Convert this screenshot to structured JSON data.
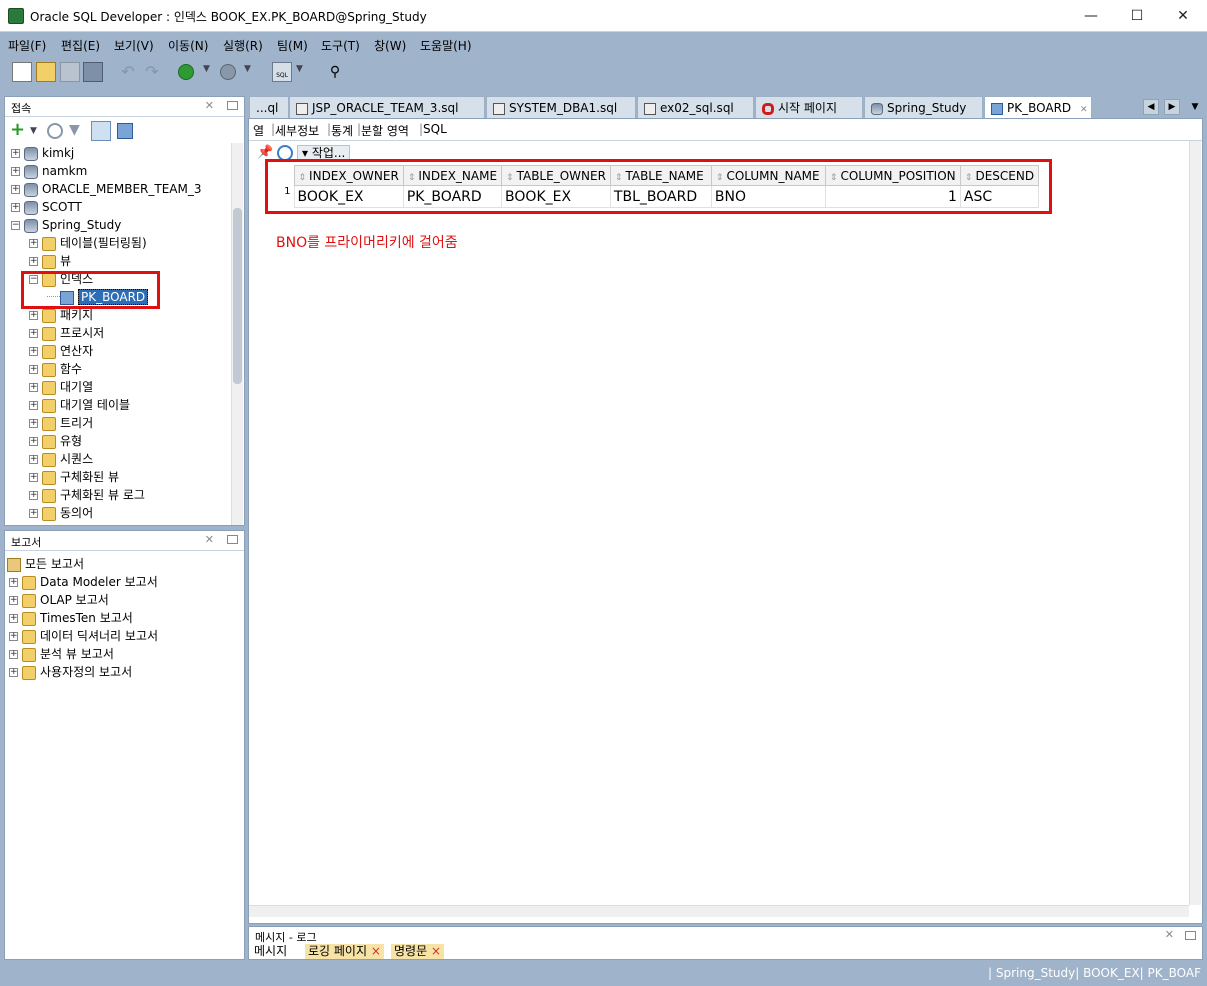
{
  "window": {
    "title": "Oracle SQL Developer : 인덱스 BOOK_EX.PK_BOARD@Spring_Study",
    "minimize": "—",
    "maximize": "☐",
    "close": "✕"
  },
  "menu": [
    "파일(F)",
    "편집(E)",
    "보기(V)",
    "이동(N)",
    "실행(R)",
    "팀(M)",
    "도구(T)",
    "창(W)",
    "도움말(H)"
  ],
  "connections_panel": {
    "title": "접속",
    "items": [
      {
        "label": "kimkj",
        "icon": "database-icon",
        "level": 0,
        "expander": "+"
      },
      {
        "label": "namkm",
        "icon": "database-icon",
        "level": 0,
        "expander": "+"
      },
      {
        "label": "ORACLE_MEMBER_TEAM_3",
        "icon": "database-icon",
        "level": 0,
        "expander": "+"
      },
      {
        "label": "SCOTT",
        "icon": "database-icon",
        "level": 0,
        "expander": "+"
      },
      {
        "label": "Spring_Study",
        "icon": "database-icon",
        "level": 0,
        "expander": "−"
      },
      {
        "label": "테이블(필터링됨)",
        "icon": "folder-icon",
        "level": 1,
        "expander": "+"
      },
      {
        "label": "뷰",
        "icon": "folder-icon",
        "level": 1,
        "expander": "+"
      },
      {
        "label": "인덱스",
        "icon": "folder-icon",
        "level": 1,
        "expander": "−"
      },
      {
        "label": "PK_BOARD",
        "icon": "index-icon",
        "level": 2,
        "expander": "",
        "selected": true
      },
      {
        "label": "패키지",
        "icon": "folder-icon",
        "level": 1,
        "expander": "+"
      },
      {
        "label": "프로시저",
        "icon": "folder-icon",
        "level": 1,
        "expander": "+"
      },
      {
        "label": "연산자",
        "icon": "folder-icon",
        "level": 1,
        "expander": "+"
      },
      {
        "label": "함수",
        "icon": "folder-icon",
        "level": 1,
        "expander": "+"
      },
      {
        "label": "대기열",
        "icon": "folder-icon",
        "level": 1,
        "expander": "+"
      },
      {
        "label": "대기열 테이블",
        "icon": "folder-icon",
        "level": 1,
        "expander": "+"
      },
      {
        "label": "트리거",
        "icon": "folder-icon",
        "level": 1,
        "expander": "+"
      },
      {
        "label": "유형",
        "icon": "folder-icon",
        "level": 1,
        "expander": "+"
      },
      {
        "label": "시퀀스",
        "icon": "folder-icon",
        "level": 1,
        "expander": "+"
      },
      {
        "label": "구체화된 뷰",
        "icon": "folder-icon",
        "level": 1,
        "expander": "+"
      },
      {
        "label": "구체화된 뷰 로그",
        "icon": "folder-icon",
        "level": 1,
        "expander": "+"
      },
      {
        "label": "동의어",
        "icon": "folder-icon",
        "level": 1,
        "expander": "+"
      }
    ]
  },
  "reports_panel": {
    "title": "보고서",
    "root": "모든 보고서",
    "items": [
      "Data Modeler 보고서",
      "OLAP 보고서",
      "TimesTen 보고서",
      "데이터 딕셔너리 보고서",
      "분석 뷰 보고서",
      "사용자정의 보고서"
    ]
  },
  "editor_tabs": [
    {
      "label": "...ql",
      "icon": ""
    },
    {
      "label": "JSP_ORACLE_TEAM_3.sql",
      "icon": "sql-file-icon"
    },
    {
      "label": "SYSTEM_DBA1.sql",
      "icon": "sql-file-icon"
    },
    {
      "label": "ex02_sql.sql",
      "icon": "sql-file-icon"
    },
    {
      "label": "시작 페이지",
      "icon": "oracle-icon"
    },
    {
      "label": "Spring_Study",
      "icon": "database-icon"
    },
    {
      "label": "PK_BOARD",
      "icon": "index-icon",
      "active": true
    }
  ],
  "sub_tabs": [
    "열",
    "세부정보",
    "통계",
    "분할 영역",
    "SQL"
  ],
  "actions_label": "▾ 작업...",
  "grid": {
    "columns": [
      "INDEX_OWNER",
      "INDEX_NAME",
      "TABLE_OWNER",
      "TABLE_NAME",
      "COLUMN_NAME",
      "COLUMN_POSITION",
      "DESCEND"
    ],
    "rows": [
      {
        "num": "1",
        "cells": [
          "BOOK_EX",
          "PK_BOARD",
          "BOOK_EX",
          "TBL_BOARD",
          "BNO",
          "1",
          "ASC"
        ]
      }
    ]
  },
  "annotation": "BNO를 프라이머리키에 걸어줌",
  "message_panel": {
    "title": "메시지 - 로그",
    "tabs": [
      "메시지",
      "로깅 페이지",
      "명령문"
    ]
  },
  "status_bar": "| Spring_Study| BOOK_EX| PK_BOAF",
  "colors": {
    "highlight": "#e01010",
    "annotation": "#e01010",
    "chrome": "#9fb3ca"
  }
}
